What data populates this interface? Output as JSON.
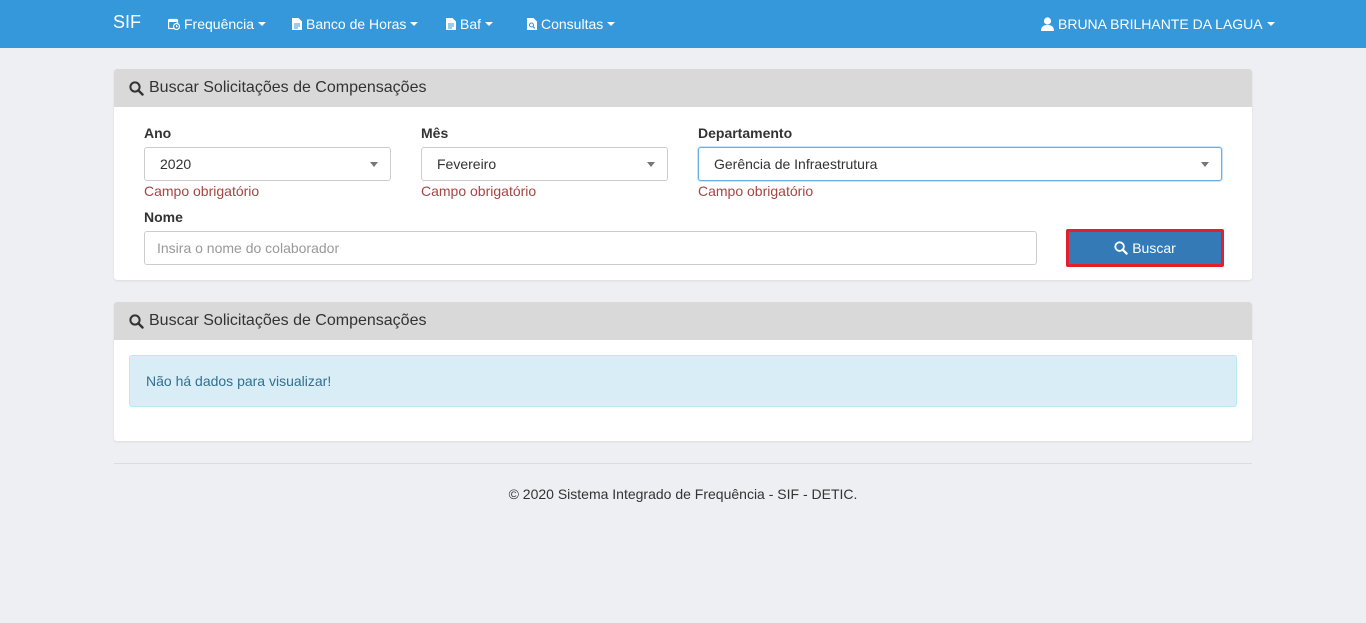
{
  "navbar": {
    "brand": "SIF",
    "menus": [
      {
        "label": "Frequência",
        "icon": "calendar-clock-icon"
      },
      {
        "label": "Banco de Horas",
        "icon": "document-icon"
      },
      {
        "label": "Baf",
        "icon": "document-icon"
      },
      {
        "label": "Consultas",
        "icon": "document-search-icon"
      }
    ],
    "user": {
      "label": "BRUNA BRILHANTE DA LAGUA",
      "icon": "user-icon"
    }
  },
  "search_panel": {
    "title": "Buscar Solicitações de Compensações",
    "fields": {
      "ano": {
        "label": "Ano",
        "value": "2020",
        "error": "Campo obrigatório"
      },
      "mes": {
        "label": "Mês",
        "value": "Fevereiro",
        "error": "Campo obrigatório"
      },
      "departamento": {
        "label": "Departamento",
        "value": "Gerência de Infraestrutura",
        "error": "Campo obrigatório"
      },
      "nome": {
        "label": "Nome",
        "value": "",
        "placeholder": "Insira o nome do colaborador"
      }
    },
    "button_label": "Buscar"
  },
  "results_panel": {
    "title": "Buscar Solicitações de Compensações",
    "alert": "Não há dados para visualizar!"
  },
  "footer": {
    "text": "© 2020 Sistema Integrado de Frequência - SIF - DETIC."
  },
  "colors": {
    "navbar": "#3498db",
    "primary_button": "#337ab7",
    "highlight_border": "#e3202a",
    "error_text": "#a94442",
    "alert_bg": "#d9edf7"
  }
}
